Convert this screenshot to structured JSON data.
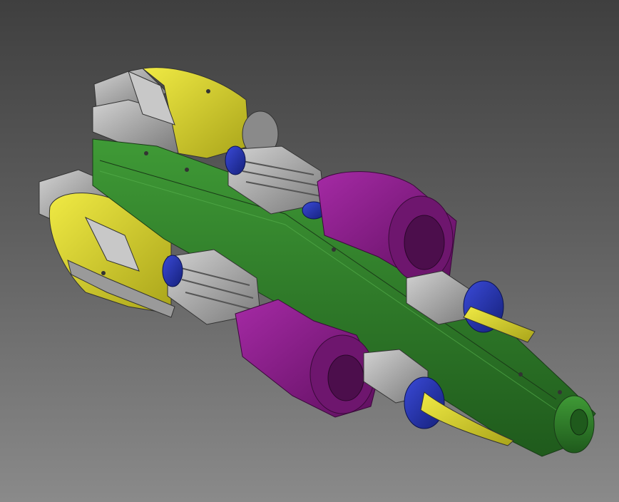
{
  "colors": {
    "background_top": "#3f3f3f",
    "background_bottom": "#8a8a8a",
    "shaft_green": "#2f7a2a",
    "housing_yellow": "#d8d22a",
    "rotor_purple": "#8a1a8a",
    "bearing_blue": "#2434b0",
    "steel_gray": "#a8a8a8"
  },
  "icons": [
    "spindle-cutaway-model"
  ]
}
